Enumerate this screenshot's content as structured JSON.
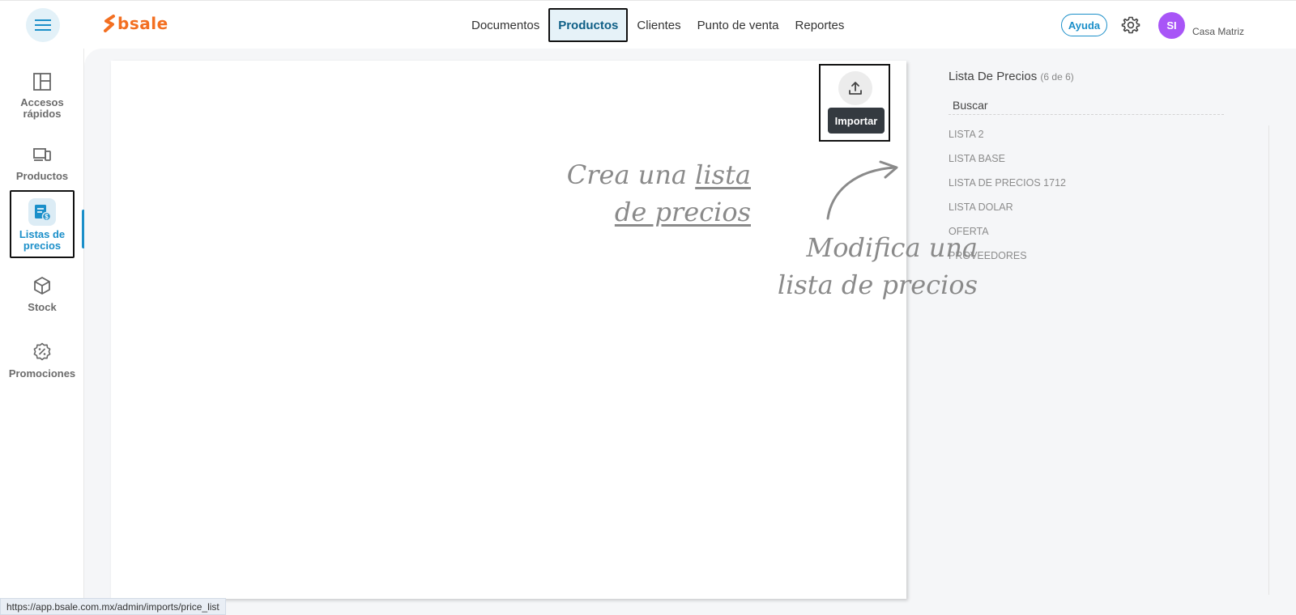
{
  "header": {
    "logo_text": "bsale",
    "nav": [
      "Documentos",
      "Productos",
      "Clientes",
      "Punto de venta",
      "Reportes"
    ],
    "active_nav": "Productos",
    "help_label": "Ayuda",
    "avatar_initials": "SI",
    "branch": "Casa Matriz"
  },
  "sidebar": {
    "items": [
      {
        "label": "Accesos rápidos",
        "icon": "layout-icon"
      },
      {
        "label": "Productos",
        "icon": "devices-icon"
      },
      {
        "label": "Listas de precios",
        "icon": "price-list-icon",
        "active": true
      },
      {
        "label": "Stock",
        "icon": "box-icon"
      },
      {
        "label": "Promociones",
        "icon": "discount-badge-icon"
      }
    ]
  },
  "canvas": {
    "import_tooltip": "Importar",
    "hint_create_1": "Crea una",
    "hint_create_link_1": "lista",
    "hint_create_link_2": "de precios",
    "hint_modify_1": "Modifica una",
    "hint_modify_2": "lista de precios"
  },
  "panel": {
    "title": "Lista De Precios",
    "count": "(6 de 6)",
    "search_placeholder": "Buscar",
    "lists": [
      "LISTA 2",
      "LISTA BASE",
      "LISTA DE PRECIOS 1712",
      "LISTA DOLAR",
      "OFERTA",
      "PROVEEDORES"
    ]
  },
  "status_url": "https://app.bsale.com.mx/admin/imports/price_list",
  "colors": {
    "brand": "#f36f21",
    "accent": "#1b8fc9",
    "avatar": "#a855f7"
  }
}
